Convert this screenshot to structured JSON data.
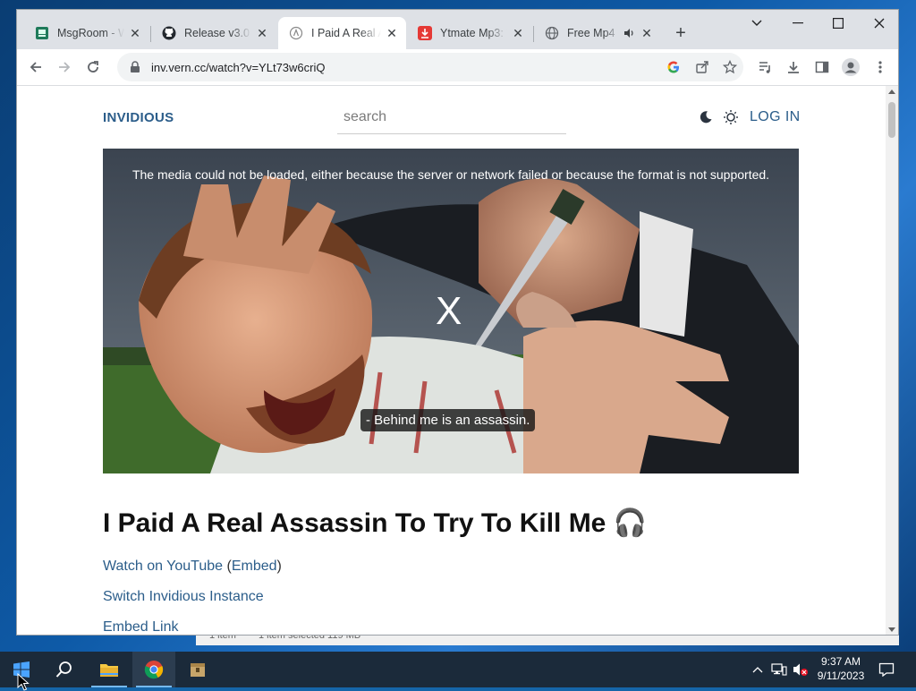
{
  "browser": {
    "tabs": [
      {
        "title": "MsgRoom - W",
        "favicon": "msgroom-icon"
      },
      {
        "title": "Release v3.0 R",
        "favicon": "github-icon"
      },
      {
        "title": "I Paid A Real A",
        "favicon": "invidious-icon",
        "active": true
      },
      {
        "title": "Ytmate Mp3: V",
        "favicon": "ytmate-download-icon"
      },
      {
        "title": "Free Mp4",
        "favicon": "globe-icon",
        "audio": true
      }
    ],
    "url": "inv.vern.cc/watch?v=YLt73w6criQ"
  },
  "site": {
    "logo": "INVIDIOUS",
    "search_placeholder": "search",
    "login_label": "LOG IN"
  },
  "player": {
    "error_message": "The media could not be loaded, either because the server or network failed or because the format is not supported.",
    "close_glyph": "X",
    "caption": "- Behind me is an assassin."
  },
  "video": {
    "title": "I Paid A Real Assassin To Try To Kill Me 🎧",
    "watch_on_youtube": "Watch on YouTube",
    "embed_paren_open": " (",
    "embed_label": "Embed",
    "embed_paren_close": ")",
    "switch_instance": "Switch Invidious Instance",
    "embed_link": "Embed Link"
  },
  "background_window": {
    "col1": "1 item",
    "col2": "1 item selected  119 MB"
  },
  "taskbar": {
    "time": "9:37 AM",
    "date": "9/11/2023"
  }
}
